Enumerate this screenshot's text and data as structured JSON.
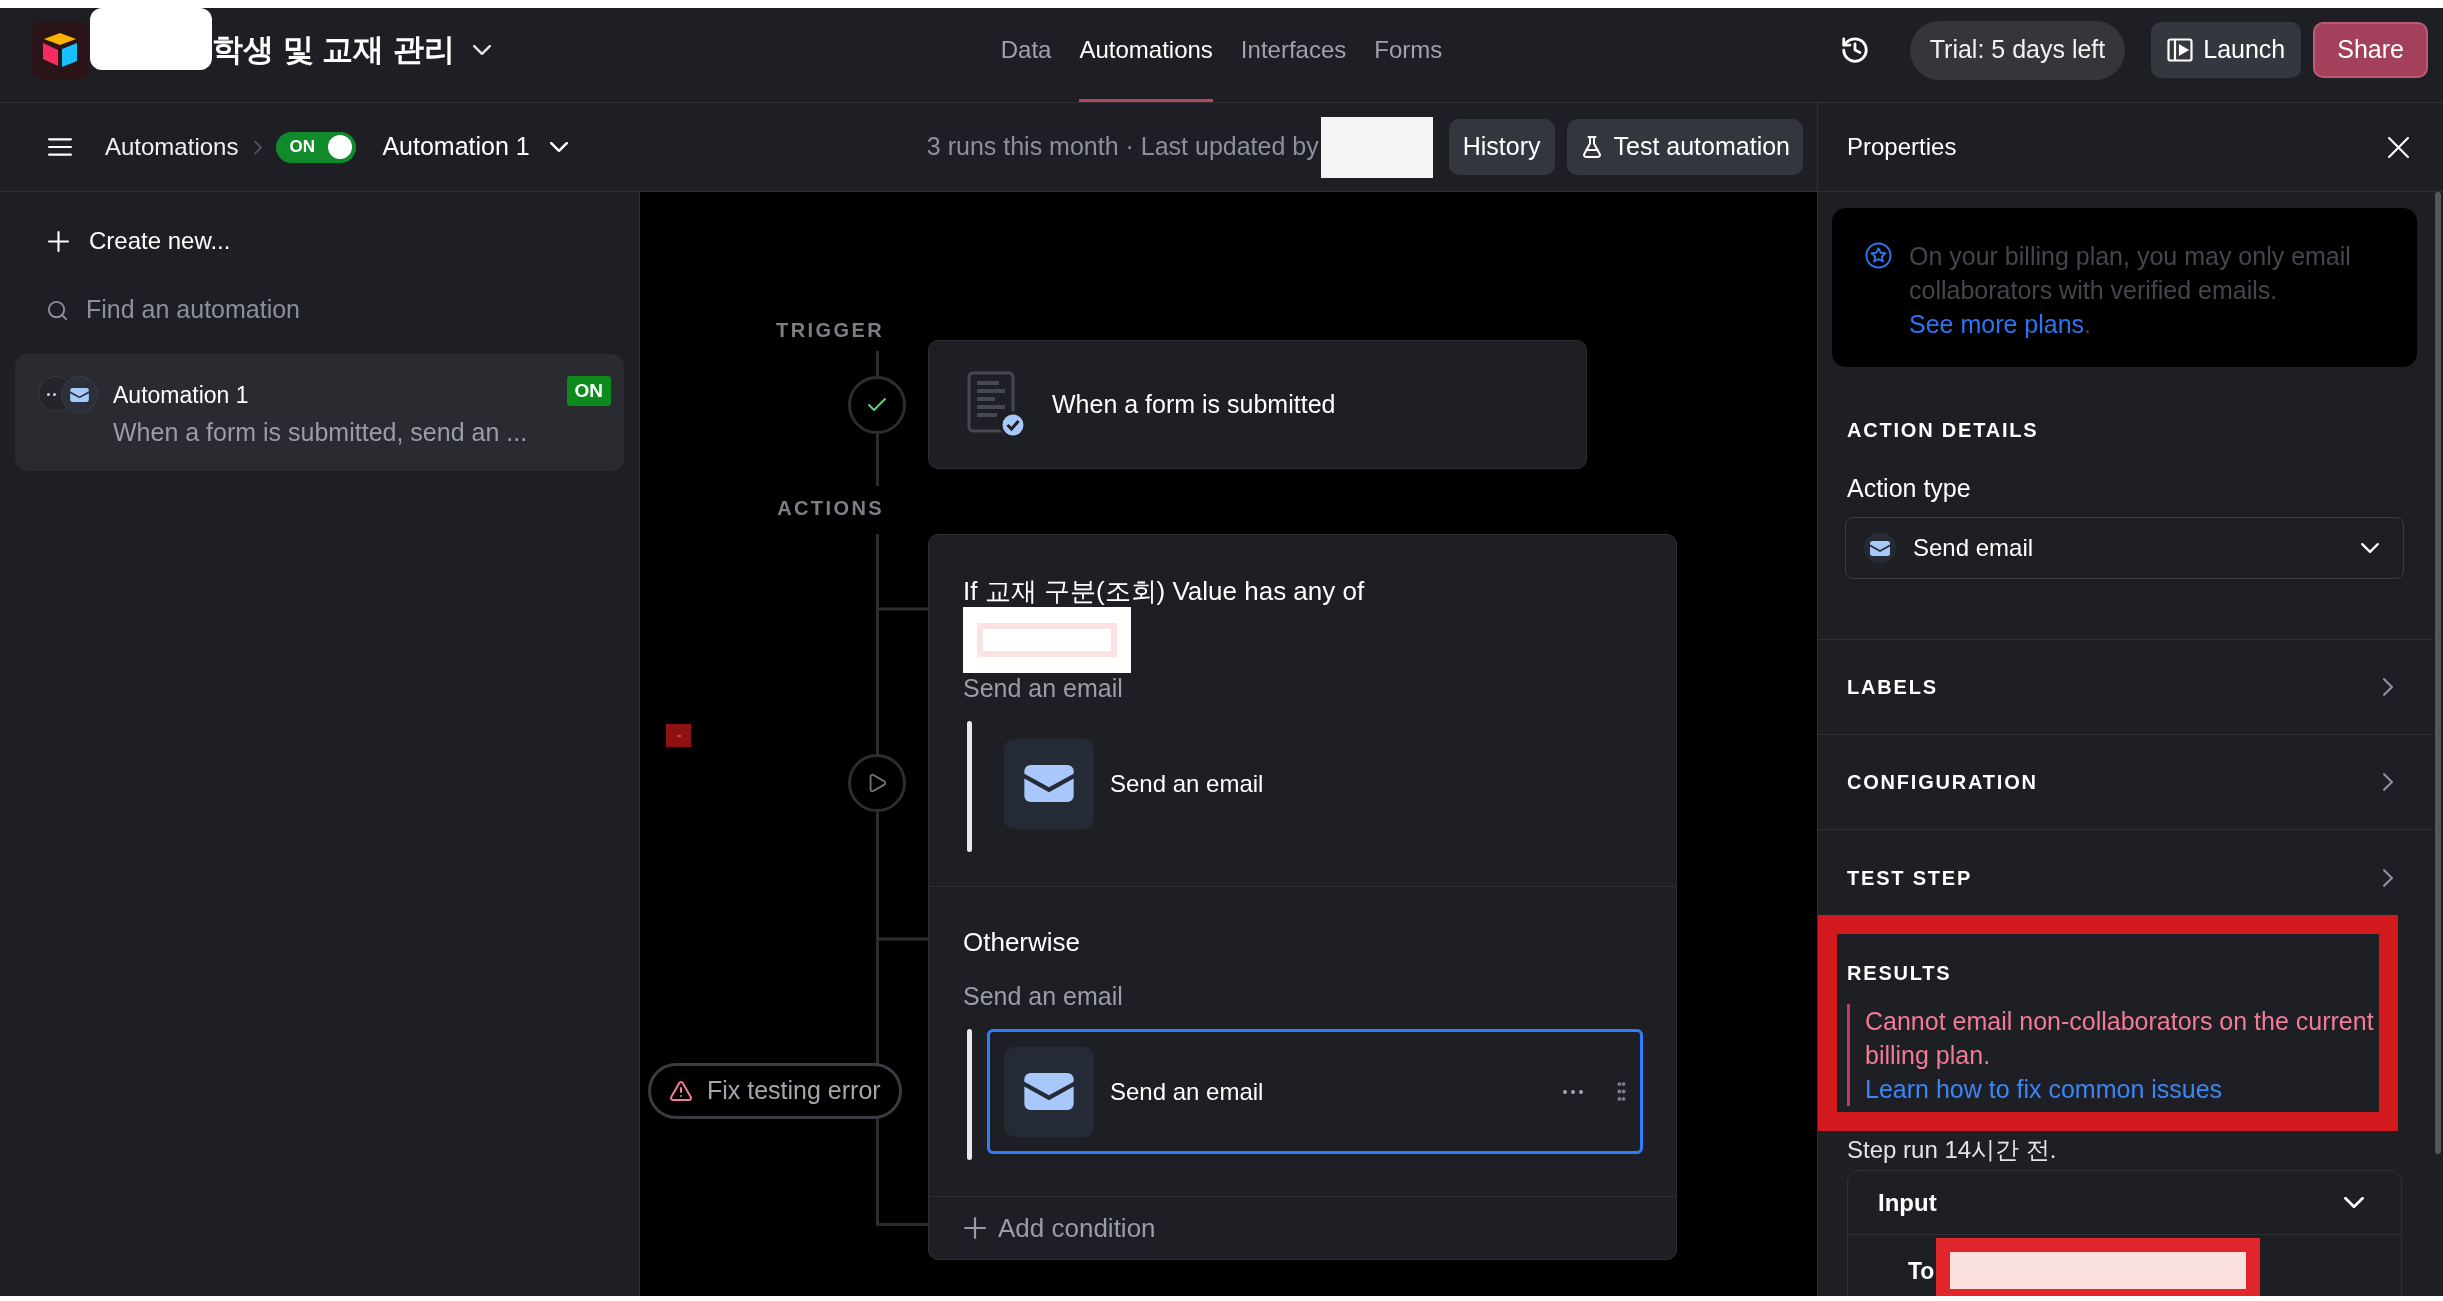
{
  "header": {
    "base_title": "학생 및 교재 관리",
    "tabs": [
      {
        "label": "Data",
        "selected": false
      },
      {
        "label": "Automations",
        "selected": true
      },
      {
        "label": "Interfaces",
        "selected": false
      },
      {
        "label": "Forms",
        "selected": false
      }
    ],
    "trial": "Trial: 5 days left",
    "launch": "Launch",
    "share": "Share"
  },
  "toolbar": {
    "breadcrumb": "Automations",
    "toggle": {
      "label": "ON",
      "on": true
    },
    "automation": "Automation 1",
    "meta": "3 runs this month · Last updated by",
    "history": "History",
    "test": "Test automation"
  },
  "sidebar": {
    "create": "Create new...",
    "search": {
      "placeholder": "Find an automation"
    },
    "items": [
      {
        "name": "Automation 1",
        "description": "When a form is submitted, send an ...",
        "status": "ON",
        "selected": true
      }
    ]
  },
  "canvas": {
    "trigger_label": "TRIGGER",
    "trigger": {
      "title": "When a form is submitted"
    },
    "actions_label": "ACTIONS",
    "branches": [
      {
        "condition": "If 교재 구분(조회) Value has any of",
        "action_label": "Send an email",
        "step": "Send an email",
        "selected": false
      },
      {
        "condition": "Otherwise",
        "action_label": "Send an email",
        "step": "Send an email",
        "selected": true
      }
    ],
    "add_condition": "Add condition",
    "error": "Fix testing error"
  },
  "properties": {
    "title": "Properties",
    "notice": {
      "text": "On your billing plan, you may only email collaborators with verified emails.",
      "link": "See more plans",
      "after": "."
    },
    "action_details": {
      "heading": "ACTION DETAILS",
      "label": "Action type",
      "value": "Send email"
    },
    "sections": [
      {
        "title": "LABELS",
        "expanded": false
      },
      {
        "title": "CONFIGURATION",
        "expanded": false
      },
      {
        "title": "TEST STEP",
        "expanded": false
      }
    ],
    "results": {
      "heading": "RESULTS",
      "error": "Cannot email non-collaborators on the current billing plan.",
      "link": "Learn how to fix common issues",
      "run": "Step run 14시간 전."
    },
    "input": {
      "title": "Input",
      "expanded": true,
      "fields": [
        {
          "label": "To"
        }
      ]
    }
  }
}
